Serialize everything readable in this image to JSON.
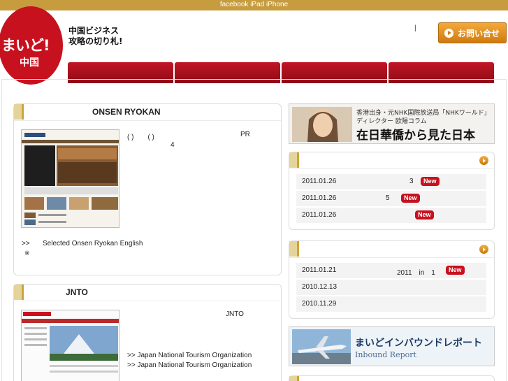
{
  "topbar": {
    "links": "facebook iPad iPhone"
  },
  "logo": {
    "line1": "まいど!",
    "line2": "中国"
  },
  "tagline": {
    "line1": "中国ビジネス",
    "line2": "攻略の切り札!"
  },
  "header": {
    "separator": "|",
    "contact_label": "お問い合せ"
  },
  "onsen": {
    "title": "ONSEN RYOKAN",
    "desc1": "( )　　( )",
    "desc_pr": "PR",
    "desc2": "4",
    "link_prefix": ">>",
    "link_text": "Selected Onsen Ryokan English",
    "note": "※"
  },
  "jnto": {
    "title": "JNTO",
    "desc": "JNTO",
    "link1": ">> Japan National Tourism Organization",
    "link2": ">> Japan National Tourism Organization"
  },
  "column_banner": {
    "line1": "香港出身・元NHK国際放送局「NHKワールド」",
    "line2": "ディレクター 欧陽コラム",
    "title": "在日華僑から見た日本"
  },
  "news1": [
    {
      "date": "2011.01.26",
      "text": "3",
      "badge": "New"
    },
    {
      "date": "2011.01.26",
      "text": "5",
      "badge": "New"
    },
    {
      "date": "2011.01.26",
      "text": "",
      "badge": "New"
    }
  ],
  "news2": [
    {
      "date": "2011.01.21",
      "text": "2011　in　1",
      "badge": "New"
    },
    {
      "date": "2010.12.13",
      "text": "",
      "badge": ""
    },
    {
      "date": "2010.11.29",
      "text": "",
      "badge": ""
    }
  ],
  "inbound_banner": {
    "title": "まいどインバウンドレポート",
    "subtitle": "Inbound Report"
  },
  "colors": {
    "brand_red": "#c8111e",
    "gold": "#c69c3e",
    "orange": "#e08d1e"
  }
}
